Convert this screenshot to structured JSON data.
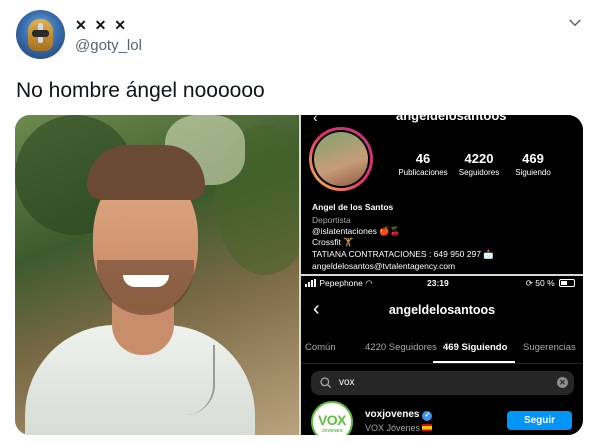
{
  "tweet": {
    "display_name": "✕ ✕ ✕",
    "handle": "@goty_lol",
    "text": "No hombre ángel noooooo"
  },
  "profile_screenshot": {
    "username_cut": "angeldelosantoos",
    "stats": [
      {
        "value": "46",
        "label": "Publicaciones"
      },
      {
        "value": "4220",
        "label": "Seguidores"
      },
      {
        "value": "469",
        "label": "Siguiendo"
      }
    ],
    "bio": {
      "name": "Angel de los Santos",
      "category": "Deportista",
      "line1": "@islatentaciones 🍎🍒",
      "line2": "Crossfit 🏋",
      "line3": "TATIANA CONTRATACIONES : 649 950 297 📩",
      "line4": "angeldelosantos@tvtalentagency.com"
    }
  },
  "following_screenshot": {
    "status": {
      "carrier": "Pepephone",
      "time": "23:19",
      "battery": "50 %"
    },
    "title": "angeldelosantoos",
    "tabs": [
      "Común",
      "4220 Seguidores",
      "469 Siguiendo",
      "Sugerencias"
    ],
    "active_tab_index": 2,
    "search_query": "vox",
    "result": {
      "username": "voxjovenes",
      "full_name": "VOX Jóvenes",
      "logo_text": "VOX",
      "logo_sub": "JÓVENES",
      "button": "Seguir"
    }
  },
  "colors": {
    "follow_blue": "#0095f6",
    "vox_green": "#5fbf3f",
    "verified_blue": "#3897f0"
  }
}
